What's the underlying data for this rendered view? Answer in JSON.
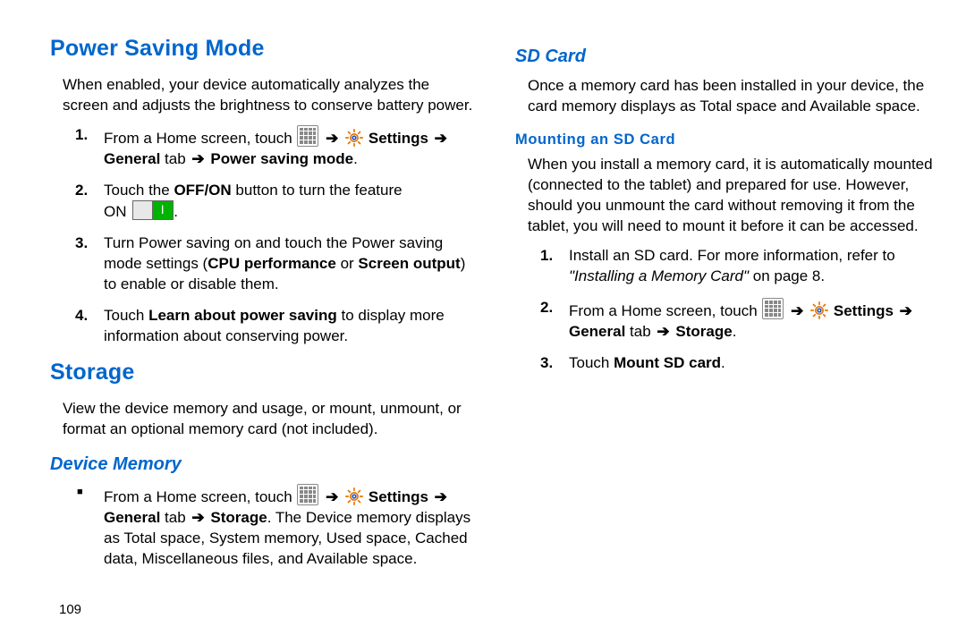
{
  "page_number": "109",
  "left": {
    "h1_power": "Power Saving Mode",
    "p_power": "When enabled, your device automatically analyzes the screen and adjusts the brightness to conserve battery power.",
    "step1_a": "From a Home screen, touch ",
    "settings_word": " Settings ",
    "general_tab": "General",
    "tab_word": " tab ",
    "power_mode": "Power saving mode",
    "step2_a": "Touch the ",
    "offon": "OFF/ON",
    "step2_b": " button to turn the feature",
    "on_word": "ON",
    "step3_a": "Turn Power saving on and touch the Power saving mode settings (",
    "cpu": "CPU performance",
    "or_word": " or ",
    "screenout": "Screen output",
    "step3_b": ") to enable or disable them.",
    "step4_a": "Touch ",
    "learn": "Learn about power saving",
    "step4_b": " to display more information about conserving power.",
    "h1_storage": "Storage",
    "p_storage": "View the device memory and usage, or mount, unmount, or format an optional memory card (not included).",
    "h2_devicemem": "Device Memory",
    "dm_a": "From a Home screen, touch ",
    "storage_word": "Storage",
    "dm_b": ". The Device memory displays as Total space, System memory, Used space, Cached data, Miscellaneous files, and Available space."
  },
  "right": {
    "h2_sd": "SD Card",
    "p_sd": "Once a memory card has been installed in your device, the card memory displays as Total space and Available space.",
    "h3_mount": "Mounting an SD Card",
    "p_mount": "When you install a memory card, it is automatically mounted (connected to the tablet) and prepared for use. However, should you unmount the card without removing it from the tablet, you will need to mount it before it can be accessed.",
    "r1_a": "Install an SD card. For more information, refer to ",
    "r1_i": "\"Installing a Memory Card\"",
    "r1_b": " on page 8.",
    "r2_a": "From a Home screen, touch ",
    "r3_a": "Touch ",
    "mountsd": "Mount SD card",
    "period": "."
  },
  "labels": {
    "one": "1.",
    "two": "2.",
    "three": "3.",
    "four": "4.",
    "arrow": "➔"
  }
}
